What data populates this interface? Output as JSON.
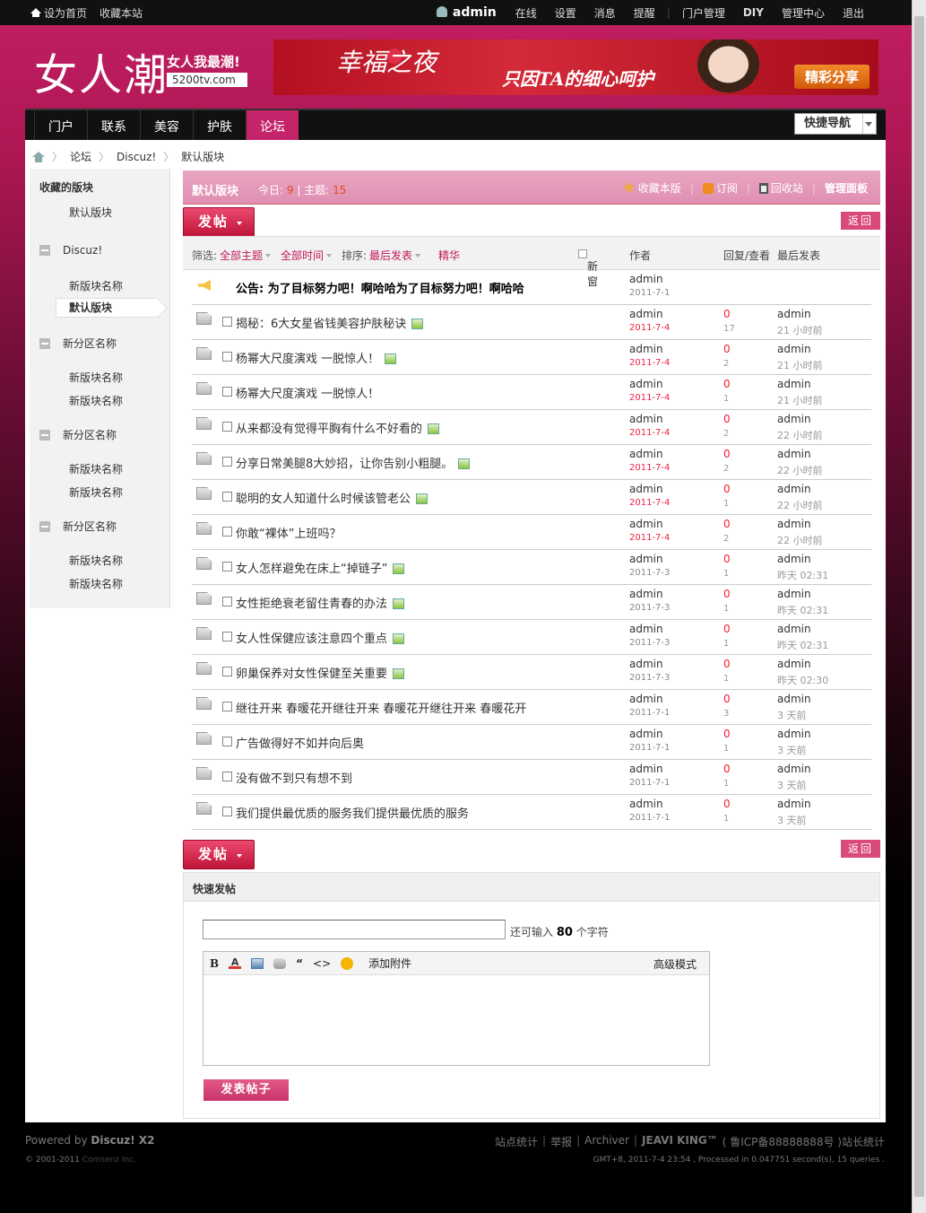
{
  "topbar": {
    "set_home": "设为首页",
    "bookmark": "收藏本站",
    "user": "admin",
    "links": [
      "在线",
      "设置",
      "消息",
      "提醒",
      "门户管理",
      "DIY",
      "管理中心",
      "退出"
    ]
  },
  "header": {
    "logo": "女人潮",
    "slogan": "女人我最潮!",
    "domain": "5200tv.com",
    "banner": {
      "title": "幸福之夜",
      "subtitle": "只因TA的细心呵护",
      "button": "精彩分享"
    }
  },
  "nav": {
    "items": [
      "门户",
      "联系",
      "美容",
      "护肤",
      "论坛"
    ],
    "current": "论坛",
    "quick_nav": "快捷导航"
  },
  "breadcrumb": [
    "论坛",
    "Discuz!",
    "默认版块"
  ],
  "sidebar": {
    "fav_title": "收藏的版块",
    "fav_items": [
      "默认版块"
    ],
    "groups": [
      {
        "name": "Discuz!",
        "items": [
          "新版块名称",
          "默认版块"
        ]
      },
      {
        "name": "新分区名称",
        "items": [
          "新版块名称",
          "新版块名称"
        ]
      },
      {
        "name": "新分区名称",
        "items": [
          "新版块名称",
          "新版块名称"
        ]
      },
      {
        "name": "新分区名称",
        "items": [
          "新版块名称",
          "新版块名称"
        ]
      }
    ]
  },
  "forum": {
    "name": "默认版块",
    "today_label": "今日:",
    "today": "9",
    "threads_label": "主题:",
    "threads": "15",
    "actions": {
      "favorite": "收藏本版",
      "subscribe": "订阅",
      "recycle": "回收站",
      "admin": "管理面板"
    },
    "post_button": "发帖",
    "back_button": "返回"
  },
  "filter": {
    "label": "筛选:",
    "all_threads": "全部主题",
    "all_time": "全部时间",
    "sort_label": "排序:",
    "sort": "最后发表",
    "digest": "精华",
    "new_window": "新窗",
    "col_author": "作者",
    "col_replies": "回复/查看",
    "col_last": "最后发表"
  },
  "notice": {
    "title": "公告: 为了目标努力吧！啊哈哈为了目标努力吧！啊哈哈",
    "author": "admin",
    "date": "2011-7-1"
  },
  "threads": [
    {
      "title": "揭秘：6大女星省钱美容护肤秘诀",
      "img": true,
      "author": "admin",
      "date": "2011-7-4",
      "replies": "0",
      "views": "17",
      "last_user": "admin",
      "last_time": "21 小时前",
      "new": true
    },
    {
      "title": "杨幂大尺度演戏  一脱惊人！",
      "img": true,
      "author": "admin",
      "date": "2011-7-4",
      "replies": "0",
      "views": "2",
      "last_user": "admin",
      "last_time": "21 小时前",
      "new": true
    },
    {
      "title": "杨幂大尺度演戏  一脱惊人！",
      "img": false,
      "author": "admin",
      "date": "2011-7-4",
      "replies": "0",
      "views": "1",
      "last_user": "admin",
      "last_time": "21 小时前",
      "new": true
    },
    {
      "title": "从来都没有觉得平胸有什么不好看的",
      "img": true,
      "author": "admin",
      "date": "2011-7-4",
      "replies": "0",
      "views": "2",
      "last_user": "admin",
      "last_time": "22 小时前",
      "new": true
    },
    {
      "title": "分享日常美腿8大妙招，让你告别小粗腿。",
      "img": true,
      "author": "admin",
      "date": "2011-7-4",
      "replies": "0",
      "views": "2",
      "last_user": "admin",
      "last_time": "22 小时前",
      "new": true
    },
    {
      "title": "聪明的女人知道什么时候该管老公",
      "img": true,
      "author": "admin",
      "date": "2011-7-4",
      "replies": "0",
      "views": "1",
      "last_user": "admin",
      "last_time": "22 小时前",
      "new": true
    },
    {
      "title": "你敢“裸体”上班吗？",
      "img": false,
      "author": "admin",
      "date": "2011-7-4",
      "replies": "0",
      "views": "2",
      "last_user": "admin",
      "last_time": "22 小时前",
      "new": true
    },
    {
      "title": "女人怎样避免在床上“掉链子”",
      "img": true,
      "author": "admin",
      "date": "2011-7-3",
      "replies": "0",
      "views": "1",
      "last_user": "admin",
      "last_time": "昨天 02:31",
      "new": false
    },
    {
      "title": "女性拒绝衰老留住青春的办法",
      "img": true,
      "author": "admin",
      "date": "2011-7-3",
      "replies": "0",
      "views": "1",
      "last_user": "admin",
      "last_time": "昨天 02:31",
      "new": false
    },
    {
      "title": "女人性保健应该注意四个重点",
      "img": true,
      "author": "admin",
      "date": "2011-7-3",
      "replies": "0",
      "views": "1",
      "last_user": "admin",
      "last_time": "昨天 02:31",
      "new": false
    },
    {
      "title": "卵巢保养对女性保健至关重要",
      "img": true,
      "author": "admin",
      "date": "2011-7-3",
      "replies": "0",
      "views": "1",
      "last_user": "admin",
      "last_time": "昨天 02:30",
      "new": false
    },
    {
      "title": "继往开来  春暖花开继往开来  春暖花开继往开来  春暖花开",
      "img": false,
      "author": "admin",
      "date": "2011-7-1",
      "replies": "0",
      "views": "3",
      "last_user": "admin",
      "last_time": "3 天前",
      "new": false
    },
    {
      "title": "广告做得好不如并向后奥",
      "img": false,
      "author": "admin",
      "date": "2011-7-1",
      "replies": "0",
      "views": "1",
      "last_user": "admin",
      "last_time": "3 天前",
      "new": false
    },
    {
      "title": "没有做不到只有想不到",
      "img": false,
      "author": "admin",
      "date": "2011-7-1",
      "replies": "0",
      "views": "1",
      "last_user": "admin",
      "last_time": "3 天前",
      "new": false
    },
    {
      "title": "我们提供最优质的服务我们提供最优质的服务",
      "img": false,
      "author": "admin",
      "date": "2011-7-1",
      "replies": "0",
      "views": "1",
      "last_user": "admin",
      "last_time": "3 天前",
      "new": false
    }
  ],
  "quick_post": {
    "title": "快速发帖",
    "tip_prefix": "还可输入",
    "tip_count": "80",
    "tip_suffix": "个字符",
    "attach": "添加附件",
    "advanced": "高级模式",
    "submit": "发表帖子"
  },
  "footer": {
    "powered_prefix": "Powered by",
    "powered": "Discuz! X2",
    "copyright_prefix": "© 2001-2011",
    "copyright": "Comsenz Inc.",
    "links": [
      "站点统计",
      "举报",
      "Archiver"
    ],
    "brand": "JEAVI KING™",
    "icp": "( 鲁ICP备88888888号 )站长统计",
    "time": "GMT+8, 2011-7-4 23:54 , Processed in 0.047751 second(s), 15 queries ."
  },
  "colors": {
    "accent": "#c6246a",
    "header_pink": "#e08fb2",
    "red_text": "#e22233"
  }
}
